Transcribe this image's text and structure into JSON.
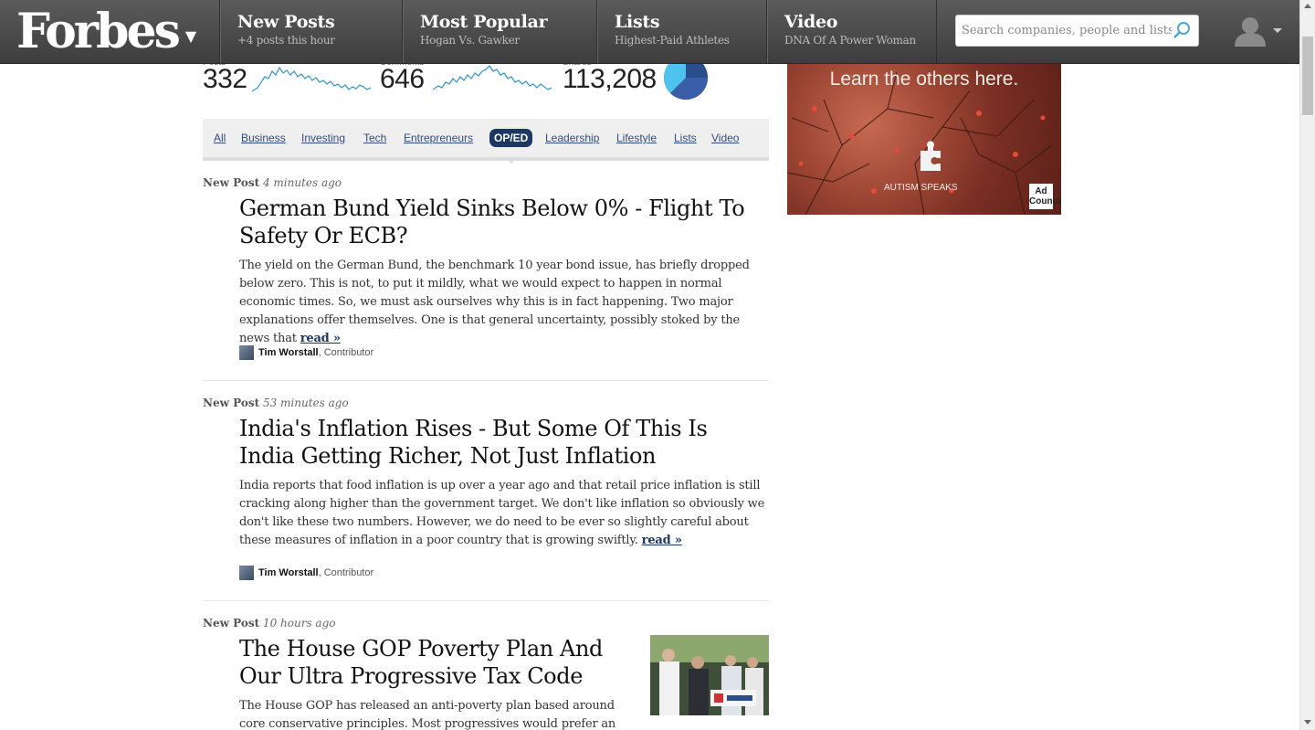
{
  "header": {
    "logo": "Forbes",
    "nav": [
      {
        "title": "New Posts",
        "subtitle": "+4 posts this hour"
      },
      {
        "title": "Most Popular",
        "subtitle": "Hogan Vs. Gawker"
      },
      {
        "title": "Lists",
        "subtitle": "Highest-Paid Athletes"
      },
      {
        "title": "Video",
        "subtitle": "DNA Of A Power Woman"
      }
    ],
    "search_placeholder": "Search companies, people and lists"
  },
  "stats": [
    {
      "label": "Posts",
      "value": "332"
    },
    {
      "label": "Comments",
      "value": "646"
    },
    {
      "label": "Shares",
      "value": "113,208"
    }
  ],
  "filters": {
    "items": [
      "All",
      "Business",
      "Investing",
      "Tech",
      "Entrepreneurs",
      "OP/ED",
      "Leadership",
      "Lifestyle",
      "Lists",
      "Video"
    ],
    "active": "OP/ED"
  },
  "posts": [
    {
      "label": "New Post",
      "time": "4 minutes ago",
      "title": "German Bund Yield Sinks Below 0% - Flight To Safety Or ECB?",
      "excerpt": "The yield on the German Bund, the benchmark 10 year bond issue, has briefly dropped below zero. This is not, to put it mildly, what we would expect to happen in normal economic times. So, we must ask ourselves why this is in fact happening. Two major explanations offer themselves. One is that general uncertainty, possibly stoked by the news that",
      "read_label": "read »",
      "author": "Tim Worstall",
      "role": "Contributor"
    },
    {
      "label": "New Post",
      "time": "53 minutes ago",
      "title": "India's Inflation Rises - But Some Of This Is India Getting Richer, Not Just Inflation",
      "excerpt": "India reports that food inflation is up over a year ago and that retail price inflation is still cracking along higher than the government target. We don't like inflation so obviously we don't like these two numbers. However, we do need to be ever so slightly careful about these measures of inflation in a poor country that is growing swiftly.",
      "read_label": "read »",
      "author": "Tim Worstall",
      "role": "Contributor"
    },
    {
      "label": "New Post",
      "time": "10 hours ago",
      "title": "The House GOP Poverty Plan And Our Ultra Progressive Tax Code",
      "excerpt": "The House GOP has released an anti-poverty plan based around core conservative principles. Most progressives would prefer an"
    }
  ],
  "ad": {
    "text": "Learn the others here.",
    "brand": "AUTISM SPEAKS",
    "badge": "Ad Council"
  },
  "colors": {
    "nav_bg": "#4a4a4a",
    "link": "#334b7c",
    "active_bg": "#1d3763",
    "spark": "#3e9bcb"
  }
}
